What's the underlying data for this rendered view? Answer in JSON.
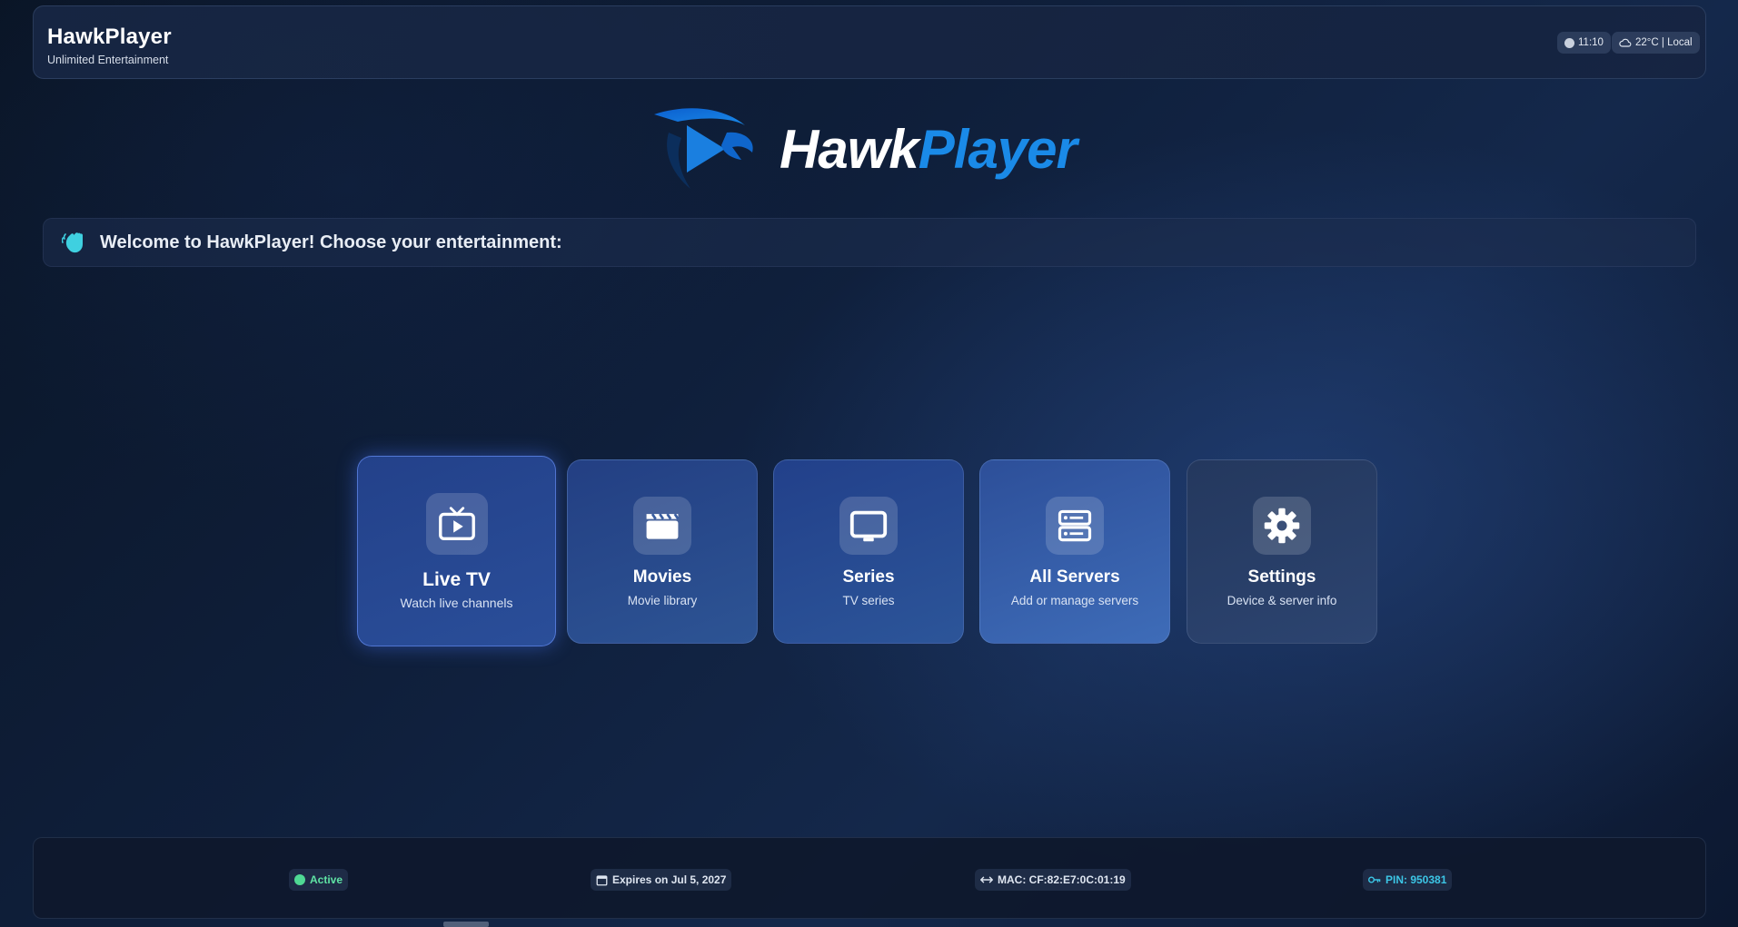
{
  "header": {
    "title": "HawkPlayer",
    "subtitle": "Unlimited Entertainment",
    "time": "11:10",
    "weather": "22°C | Local"
  },
  "logo": {
    "word_part1": "Hawk",
    "word_part2": "Player"
  },
  "welcome": {
    "text": "Welcome to HawkPlayer! Choose your entertainment:",
    "icon": "wave-icon"
  },
  "menu": [
    {
      "title": "Live TV",
      "subtitle": "Watch live channels",
      "icon": "tv-icon",
      "selected": true
    },
    {
      "title": "Movies",
      "subtitle": "Movie library",
      "icon": "clapperboard-icon"
    },
    {
      "title": "Series",
      "subtitle": "TV series",
      "icon": "monitor-icon"
    },
    {
      "title": "All Servers",
      "subtitle": "Add or manage servers",
      "icon": "server-icon"
    },
    {
      "title": "Settings",
      "subtitle": "Device & server info",
      "icon": "gear-icon"
    }
  ],
  "footer": {
    "status": "Active",
    "expiry": "Expires on Jul 5, 2027",
    "mac": "MAC: CF:82:E7:0C:01:19",
    "pin": "PIN: 950381"
  },
  "colors": {
    "accent": "#1a8ae8",
    "status_active": "#4fd994",
    "pin": "#3cc6e6",
    "background": "#0f1f3b"
  }
}
